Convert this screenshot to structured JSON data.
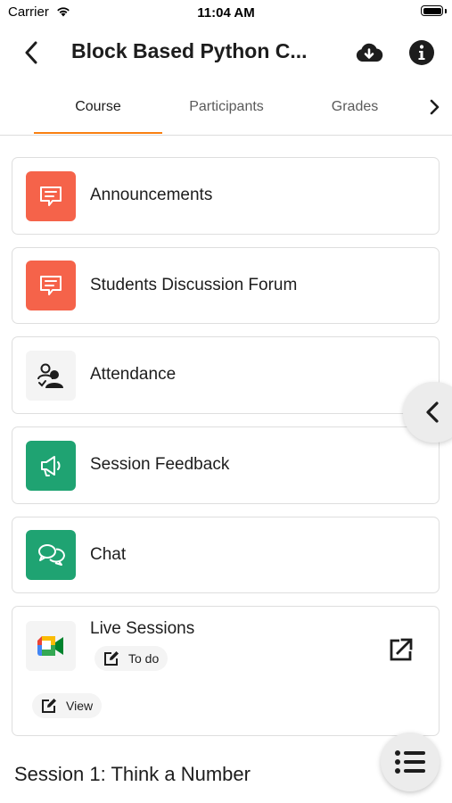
{
  "status_bar": {
    "carrier": "Carrier",
    "time": "11:04 AM"
  },
  "header": {
    "title": "Block Based Python C..."
  },
  "tabs": [
    {
      "label": "Course",
      "active": true
    },
    {
      "label": "Participants",
      "active": false
    },
    {
      "label": "Grades",
      "active": false
    }
  ],
  "activities": [
    {
      "label": "Announcements",
      "icon": "forum-icon",
      "color": "#f5634a"
    },
    {
      "label": "Students Discussion Forum",
      "icon": "forum-icon",
      "color": "#f5634a"
    },
    {
      "label": "Attendance",
      "icon": "attendance-icon",
      "color": "#f4f4f4"
    },
    {
      "label": "Session Feedback",
      "icon": "megaphone-icon",
      "color": "#1fa372"
    },
    {
      "label": "Chat",
      "icon": "chat-bubbles-icon",
      "color": "#1fa372"
    },
    {
      "label": "Live Sessions",
      "icon": "google-meet-icon",
      "todo_label": "To do",
      "view_label": "View"
    }
  ],
  "section": {
    "title": "Session 1: Think a Number"
  },
  "colors": {
    "accent": "#f98012"
  }
}
